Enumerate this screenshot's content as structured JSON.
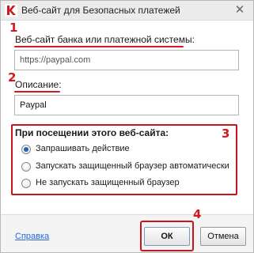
{
  "window": {
    "title": "Веб-сайт для Безопасных платежей",
    "close_glyph": "✕",
    "icon": "kaspersky-k-icon",
    "accent": "#d4181f"
  },
  "markers": [
    "1",
    "2",
    "3",
    "4"
  ],
  "url_field": {
    "label": "Веб-сайт банка или платежной системы:",
    "value": "https://paypal.com"
  },
  "description_field": {
    "label": "Описание:",
    "value": "Paypal"
  },
  "visit_group": {
    "title": "При посещении этого веб-сайта:",
    "options": [
      {
        "label": "Запрашивать действие",
        "selected": true
      },
      {
        "label": "Запускать защищенный браузер автоматически",
        "selected": false
      },
      {
        "label": "Не запускать защищенный браузер",
        "selected": false
      }
    ]
  },
  "footer": {
    "help_label": "Справка",
    "ok_label": "ОК",
    "cancel_label": "Отмена"
  }
}
